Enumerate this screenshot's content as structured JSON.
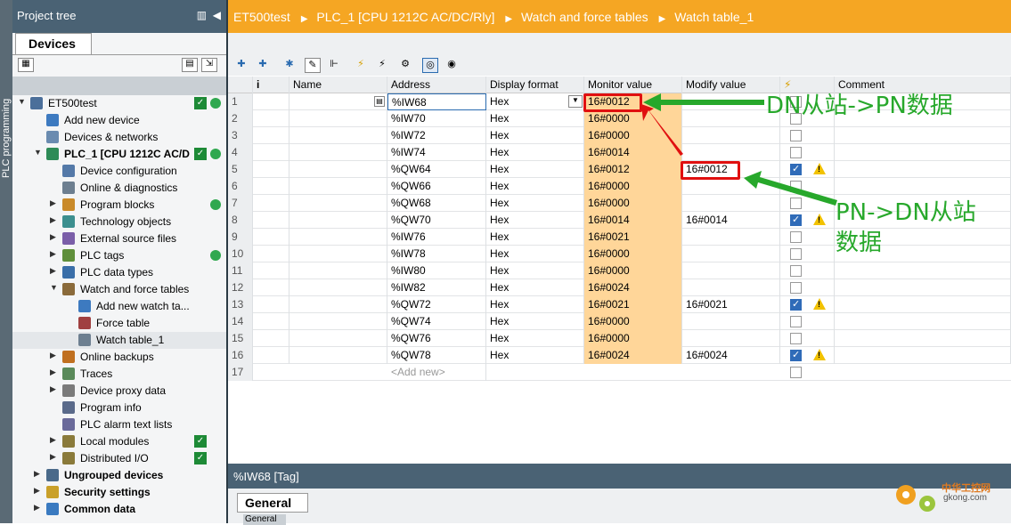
{
  "sidebar_strip": {
    "label": "PLC programming"
  },
  "project_tree": {
    "title": "Project tree",
    "tab": "Devices",
    "items": [
      {
        "label": "ET500test",
        "indent": 0,
        "arrow": "▼",
        "ok": true,
        "dot": true
      },
      {
        "label": "Add new device",
        "indent": 1,
        "arrow": ""
      },
      {
        "label": "Devices & networks",
        "indent": 1,
        "arrow": ""
      },
      {
        "label": "PLC_1 [CPU 1212C AC/D",
        "indent": 1,
        "arrow": "▼",
        "ok": true,
        "dot": true
      },
      {
        "label": "Device configuration",
        "indent": 2,
        "arrow": ""
      },
      {
        "label": "Online & diagnostics",
        "indent": 2,
        "arrow": ""
      },
      {
        "label": "Program blocks",
        "indent": 2,
        "arrow": "▶",
        "dot": true
      },
      {
        "label": "Technology objects",
        "indent": 2,
        "arrow": "▶"
      },
      {
        "label": "External source files",
        "indent": 2,
        "arrow": "▶"
      },
      {
        "label": "PLC tags",
        "indent": 2,
        "arrow": "▶",
        "dot": true
      },
      {
        "label": "PLC data types",
        "indent": 2,
        "arrow": "▶"
      },
      {
        "label": "Watch and force tables",
        "indent": 2,
        "arrow": "▼"
      },
      {
        "label": "Add new watch ta...",
        "indent": 3,
        "arrow": ""
      },
      {
        "label": "Force table",
        "indent": 3,
        "arrow": ""
      },
      {
        "label": "Watch table_1",
        "indent": 3,
        "arrow": "",
        "selected": true
      },
      {
        "label": "Online backups",
        "indent": 2,
        "arrow": "▶"
      },
      {
        "label": "Traces",
        "indent": 2,
        "arrow": "▶"
      },
      {
        "label": "Device proxy data",
        "indent": 2,
        "arrow": "▶"
      },
      {
        "label": "Program info",
        "indent": 2,
        "arrow": ""
      },
      {
        "label": "PLC alarm text lists",
        "indent": 2,
        "arrow": ""
      },
      {
        "label": "Local modules",
        "indent": 2,
        "arrow": "▶",
        "ok": true
      },
      {
        "label": "Distributed I/O",
        "indent": 2,
        "arrow": "▶",
        "ok": true
      },
      {
        "label": "Ungrouped devices",
        "indent": 1,
        "arrow": "▶"
      },
      {
        "label": "Security settings",
        "indent": 1,
        "arrow": "▶"
      },
      {
        "label": "Common data",
        "indent": 1,
        "arrow": "▶"
      }
    ]
  },
  "breadcrumb": [
    "ET500test",
    "PLC_1 [CPU 1212C AC/DC/Rly]",
    "Watch and force tables",
    "Watch table_1"
  ],
  "table": {
    "headers": {
      "i": "i",
      "name": "Name",
      "address": "Address",
      "format": "Display format",
      "monitor": "Monitor value",
      "modify": "Modify value",
      "flash": "⚡",
      "comment": "Comment"
    },
    "rows": [
      {
        "n": "1",
        "address": "%IW68",
        "format": "Hex",
        "monitor": "16#0012",
        "modify": "",
        "checked": false,
        "warn": false
      },
      {
        "n": "2",
        "address": "%IW70",
        "format": "Hex",
        "monitor": "16#0000",
        "modify": "",
        "checked": false,
        "warn": false
      },
      {
        "n": "3",
        "address": "%IW72",
        "format": "Hex",
        "monitor": "16#0000",
        "modify": "",
        "checked": false,
        "warn": false
      },
      {
        "n": "4",
        "address": "%IW74",
        "format": "Hex",
        "monitor": "16#0014",
        "modify": "",
        "checked": false,
        "warn": false
      },
      {
        "n": "5",
        "address": "%QW64",
        "format": "Hex",
        "monitor": "16#0012",
        "modify": "16#0012",
        "checked": true,
        "warn": true
      },
      {
        "n": "6",
        "address": "%QW66",
        "format": "Hex",
        "monitor": "16#0000",
        "modify": "",
        "checked": false,
        "warn": false
      },
      {
        "n": "7",
        "address": "%QW68",
        "format": "Hex",
        "monitor": "16#0000",
        "modify": "",
        "checked": false,
        "warn": false
      },
      {
        "n": "8",
        "address": "%QW70",
        "format": "Hex",
        "monitor": "16#0014",
        "modify": "16#0014",
        "checked": true,
        "warn": true
      },
      {
        "n": "9",
        "address": "%IW76",
        "format": "Hex",
        "monitor": "16#0021",
        "modify": "",
        "checked": false,
        "warn": false
      },
      {
        "n": "10",
        "address": "%IW78",
        "format": "Hex",
        "monitor": "16#0000",
        "modify": "",
        "checked": false,
        "warn": false
      },
      {
        "n": "11",
        "address": "%IW80",
        "format": "Hex",
        "monitor": "16#0000",
        "modify": "",
        "checked": false,
        "warn": false
      },
      {
        "n": "12",
        "address": "%IW82",
        "format": "Hex",
        "monitor": "16#0024",
        "modify": "",
        "checked": false,
        "warn": false
      },
      {
        "n": "13",
        "address": "%QW72",
        "format": "Hex",
        "monitor": "16#0021",
        "modify": "16#0021",
        "checked": true,
        "warn": true
      },
      {
        "n": "14",
        "address": "%QW74",
        "format": "Hex",
        "monitor": "16#0000",
        "modify": "",
        "checked": false,
        "warn": false
      },
      {
        "n": "15",
        "address": "%QW76",
        "format": "Hex",
        "monitor": "16#0000",
        "modify": "",
        "checked": false,
        "warn": false
      },
      {
        "n": "16",
        "address": "%QW78",
        "format": "Hex",
        "monitor": "16#0024",
        "modify": "16#0024",
        "checked": true,
        "warn": true
      }
    ],
    "add_new": {
      "n": "17",
      "label": "<Add new>"
    }
  },
  "inspector": {
    "title": "%IW68 [Tag]",
    "tab": "General",
    "subtab": "General"
  },
  "annotations": {
    "dn_to_pn": "DN从站->PN数据",
    "pn_to_dn_line1": "PN->DN从站",
    "pn_to_dn_line2": "数据",
    "color": "#27a82b",
    "box_color": "#e01010"
  },
  "watermark": {
    "line1": "中华工控网",
    "line2": "gkong.com"
  }
}
